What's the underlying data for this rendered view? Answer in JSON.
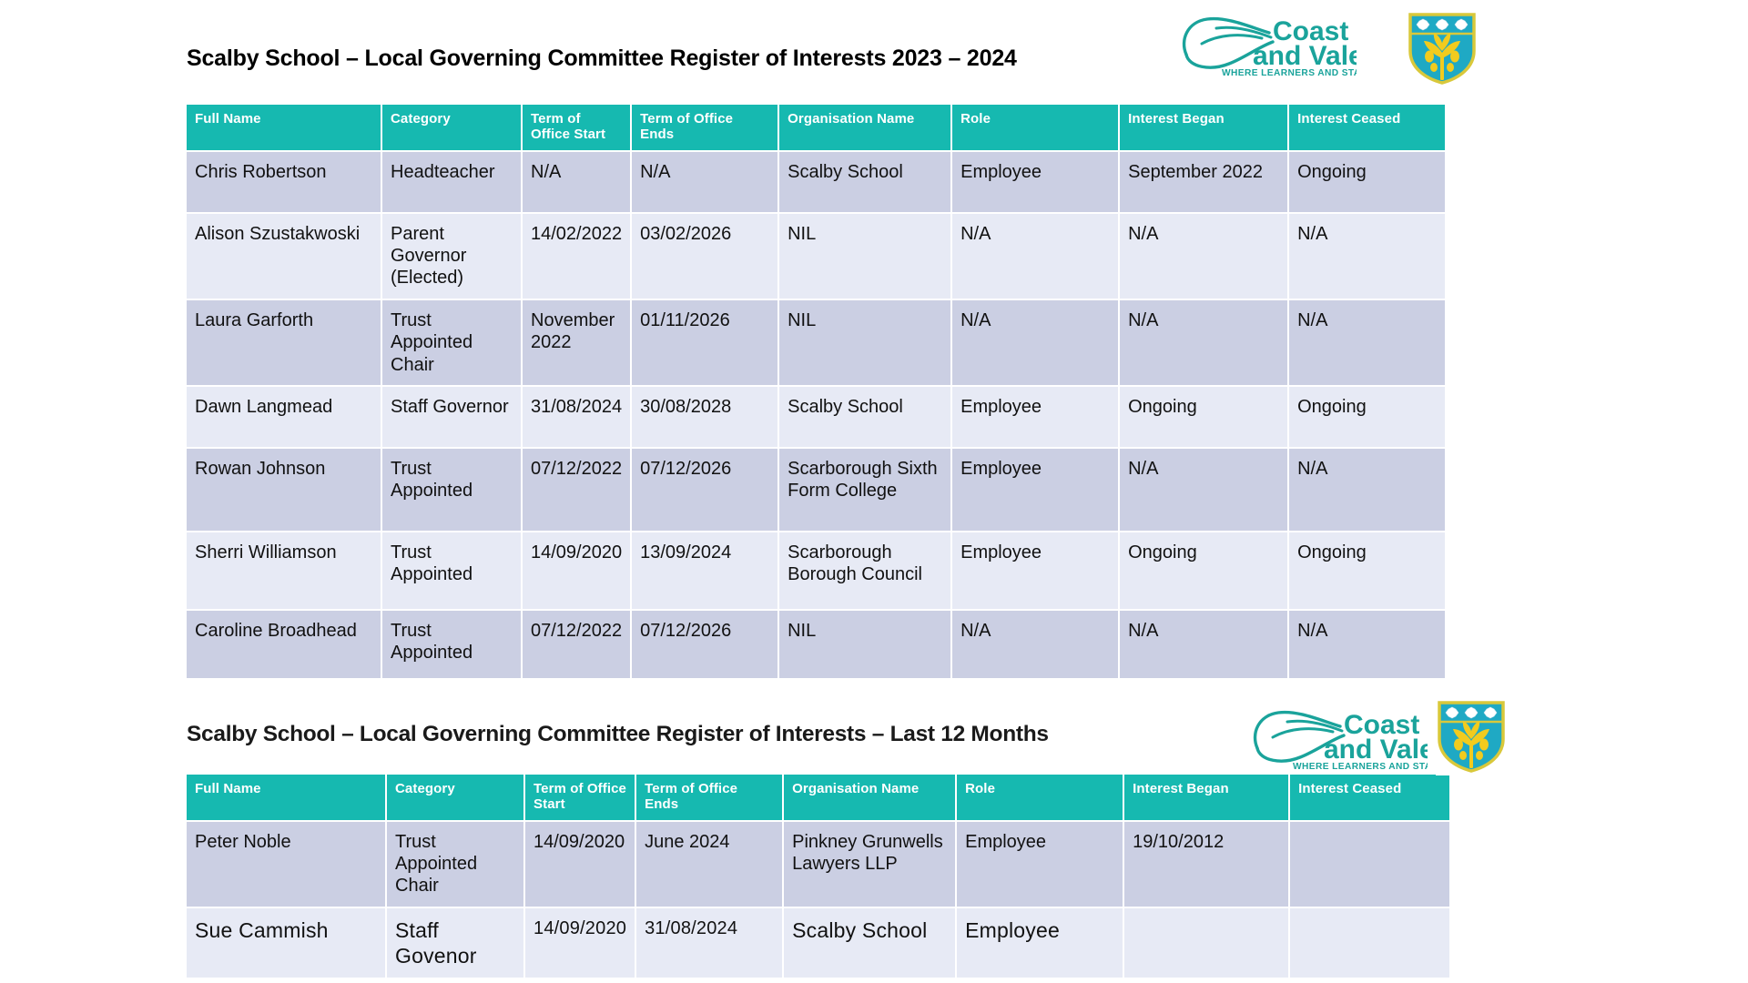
{
  "section1": {
    "title": "Scalby School – Local Governing Committee Register of Interests 2023 – 2024",
    "columns": [
      "Full Name",
      "Category",
      "Term of Office Start",
      "Term of Office Ends",
      "Organisation Name",
      "Role",
      "Interest Began",
      "Interest Ceased"
    ],
    "rows": [
      {
        "full_name": "Chris Robertson",
        "category": "Headteacher",
        "term_start": "N/A",
        "term_end": "N/A",
        "organisation": "Scalby School",
        "role": "Employee",
        "began": "September 2022",
        "ceased": "Ongoing"
      },
      {
        "full_name": "Alison Szustakwoski",
        "category": "Parent Governor (Elected)",
        "term_start": "14/02/2022",
        "term_end": "03/02/2026",
        "organisation": "NIL",
        "role": "N/A",
        "began": "N/A",
        "ceased": "N/A"
      },
      {
        "full_name": "Laura Garforth",
        "category": "Trust Appointed Chair",
        "term_start": "November 2022",
        "term_end": "01/11/2026",
        "organisation": "NIL",
        "role": "N/A",
        "began": "N/A",
        "ceased": "N/A"
      },
      {
        "full_name": "Dawn Langmead",
        "category": "Staff Governor",
        "term_start": "31/08/2024",
        "term_end": "30/08/2028",
        "organisation": "Scalby School",
        "role": "Employee",
        "began": "Ongoing",
        "ceased": "Ongoing"
      },
      {
        "full_name": "Rowan Johnson",
        "category": "Trust Appointed",
        "term_start": "07/12/2022",
        "term_end": "07/12/2026",
        "organisation": "Scarborough Sixth Form College",
        "role": "Employee",
        "began": "N/A",
        "ceased": "N/A"
      },
      {
        "full_name": "Sherri Williamson",
        "category": "Trust Appointed",
        "term_start": "14/09/2020",
        "term_end": "13/09/2024",
        "organisation": "Scarborough Borough Council",
        "role": "Employee",
        "began": "Ongoing",
        "ceased": "Ongoing"
      },
      {
        "full_name": "Caroline Broadhead",
        "category": "Trust Appointed",
        "term_start": "07/12/2022",
        "term_end": "07/12/2026",
        "organisation": "NIL",
        "role": "N/A",
        "began": "N/A",
        "ceased": "N/A"
      }
    ]
  },
  "section2": {
    "title": "Scalby School – Local Governing Committee Register of Interests – Last 12 Months",
    "columns": [
      "Full Name",
      "Category",
      "Term of Office Start",
      "Term of Office Ends",
      "Organisation Name",
      "Role",
      "Interest Began",
      "Interest Ceased"
    ],
    "rows": [
      {
        "full_name": "Peter Noble",
        "category": "Trust Appointed Chair",
        "term_start": "14/09/2020",
        "term_end": "June 2024",
        "organisation": "Pinkney Grunwells Lawyers LLP",
        "role": "Employee",
        "began": "19/10/2012",
        "ceased": ""
      },
      {
        "full_name": "Sue Cammish",
        "category": "Staff Govenor",
        "term_start": "14/09/2020",
        "term_end": "31/08/2024",
        "organisation": "Scalby School",
        "role": "Employee",
        "began": "",
        "ceased": ""
      }
    ]
  },
  "logos": {
    "coast_and_vale": {
      "line1": "Coast",
      "line2": "and Vale",
      "tagline": "WHERE LEARNERS AND STAFF THRIVE"
    },
    "school_crest": {
      "name": "scalby-school-crest"
    }
  },
  "colors": {
    "header_teal": "#16b9b0",
    "logo_teal": "#1aa39b",
    "row_dark": "#cbcfe3",
    "row_light": "#e7eaf5",
    "crest_field": "#1fa9c4",
    "crest_border": "#d9c83a",
    "crest_oak": "#f2cb1e"
  }
}
